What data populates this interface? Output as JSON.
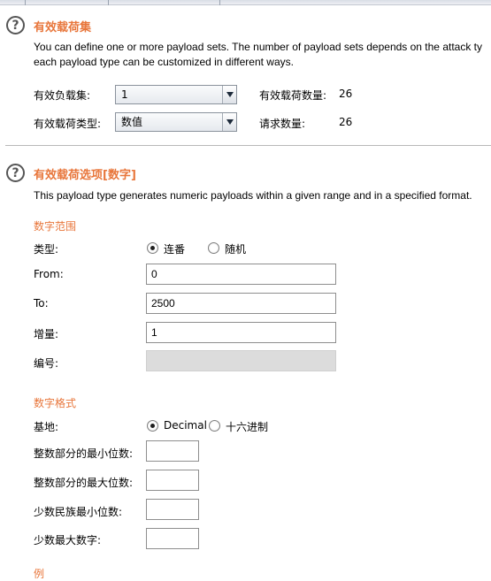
{
  "payload_sets": {
    "title": "有效载荷集",
    "description_line1": "You can define one or more payload sets. The number of payload sets depends on the attack ty",
    "description_line2": "each payload type can be customized in different ways.",
    "set_label": "有效负载集:",
    "set_value": "1",
    "type_label": "有效载荷类型:",
    "type_value": "数值",
    "count_label": "有效载荷数量:",
    "count_value": "26",
    "request_label": "请求数量:",
    "request_value": "26"
  },
  "payload_options": {
    "title": "有效载荷选项[数字]",
    "description": "This payload type generates numeric payloads within a given range and in a specified format.",
    "range": {
      "title": "数字范围",
      "type_label": "类型:",
      "radio_sequential": "连番",
      "radio_random": "随机",
      "selected": "sequential",
      "from_label": "From:",
      "from_value": "0",
      "to_label": "To:",
      "to_value": "2500",
      "step_label": "增量:",
      "step_value": "1",
      "howmany_label": "编号:",
      "howmany_value": ""
    },
    "format": {
      "title": "数字格式",
      "base_label": "基地:",
      "radio_decimal": "Decimal",
      "radio_hex": "十六进制",
      "selected": "decimal",
      "min_int_label": "整数部分的最小位数:",
      "max_int_label": "整数部分的最大位数:",
      "min_frac_label": "少数民族最小位数:",
      "max_frac_label": "少数最大数字:",
      "min_int_value": "",
      "max_int_value": "",
      "min_frac_value": "",
      "max_frac_value": ""
    },
    "example_title": "例"
  },
  "colors": {
    "accent": "#e8763b",
    "divider": "#b9b9b9",
    "disabled_field": "#dcdcdc"
  },
  "icons": {
    "help": "question-circle-icon",
    "dropdown": "chevron-down-icon"
  }
}
